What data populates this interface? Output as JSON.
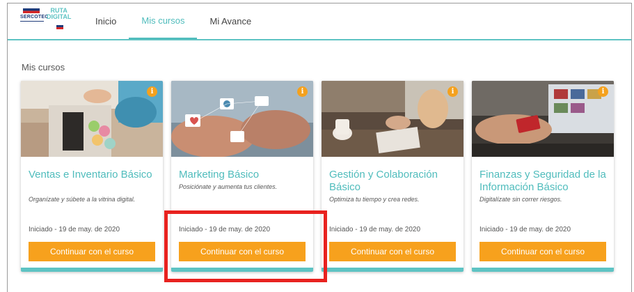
{
  "brand": {
    "sercotec": "SERCOTEC",
    "ruta": "RUTA",
    "digital": "DIGITAL"
  },
  "nav": {
    "items": [
      {
        "label": "Inicio",
        "active": false
      },
      {
        "label": "Mis cursos",
        "active": true
      },
      {
        "label": "Mi Avance",
        "active": false
      }
    ]
  },
  "section_title": "Mis cursos",
  "colors": {
    "accent": "#4fbcbc",
    "button": "#f7a11d",
    "highlight": "#e8221f"
  },
  "courses": [
    {
      "title": "Ventas e Inventario Básico",
      "subtitle": "Organízate y súbete a la vitrina digital.",
      "status": "Iniciado - 19 de may. de 2020",
      "button": "Continuar con el curso",
      "info_icon": "i"
    },
    {
      "title": "Marketing Básico",
      "subtitle": "Posiciónate y aumenta tus clientes.",
      "status": "Iniciado - 19 de may. de 2020",
      "button": "Continuar con el curso",
      "info_icon": "i"
    },
    {
      "title": "Gestión y Colaboración Básico",
      "subtitle": "Optimiza tu tiempo y crea redes.",
      "status": "Iniciado - 19 de may. de 2020",
      "button": "Continuar con el curso",
      "info_icon": "i"
    },
    {
      "title": "Finanzas y Seguridad de la Información Básico",
      "subtitle": "Digitalízate sin correr riesgos.",
      "status": "Iniciado - 19 de may. de 2020",
      "button": "Continuar con el curso",
      "info_icon": "i"
    }
  ]
}
